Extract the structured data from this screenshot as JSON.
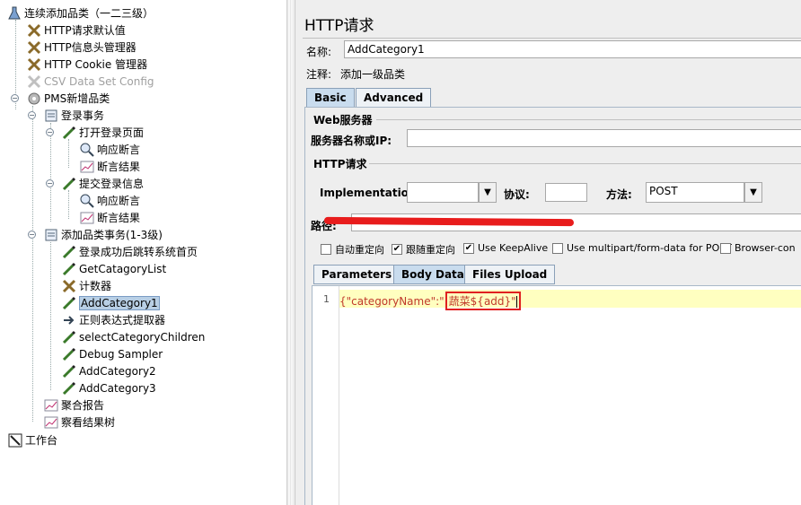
{
  "tree": {
    "root": "连续添加品类（一二三级）",
    "http_defaults": "HTTP请求默认值",
    "header_manager": "HTTP信息头管理器",
    "cookie_manager": "HTTP Cookie 管理器",
    "csv_config": "CSV Data Set Config",
    "thread_group": "PMS新增品类",
    "login_txn": "登录事务",
    "open_login": "打开登录页面",
    "resp_assert_1": "响应断言",
    "assert_result_1": "断言结果",
    "submit_login": "提交登录信息",
    "resp_assert_2": "响应断言",
    "assert_result_2": "断言结果",
    "add_txn": "添加品类事务(1-3级)",
    "redirect_home": "登录成功后跳转系统首页",
    "get_category_list": "GetCatagoryList",
    "counter": "计数器",
    "add_category_1": "AddCategory1",
    "regex_extractor": "正则表达式提取器",
    "select_children": "selectCategoryChildren",
    "debug_sampler": "Debug Sampler",
    "add_category_2": "AddCategory2",
    "add_category_3": "AddCategory3",
    "aggregate_report": "聚合报告",
    "view_results_tree": "察看结果树",
    "workbench": "工作台"
  },
  "panel": {
    "title": "HTTP请求",
    "name_label": "名称:",
    "name_value": "AddCategory1",
    "comment_label": "注释:",
    "comment_value": "添加一级品类",
    "tab_basic": "Basic",
    "tab_advanced": "Advanced",
    "web_server_section": "Web服务器",
    "server_label": "服务器名称或IP:",
    "http_section": "HTTP请求",
    "impl_label": "Implementation:",
    "protocol_label": "协议:",
    "method_label": "方法:",
    "method_value": "POST",
    "path_label": "路径:",
    "cb_auto_redirect": "自动重定向",
    "cb_follow_redirect": "跟随重定向",
    "cb_keepalive": "Use KeepAlive",
    "cb_multipart": "Use multipart/form-data for POST",
    "cb_browser": "Browser-con",
    "subtab_parameters": "Parameters",
    "subtab_body": "Body Data",
    "subtab_files": "Files Upload",
    "line_number": "1",
    "body_text": "{\"categoryName\":\"",
    "body_highlight": "蔬菜${add}\""
  },
  "colors": {
    "editor_line": "#ffffc0",
    "json_text": "#c0392b",
    "highlight_box": "#e02020",
    "redact": "#e81c1c"
  }
}
